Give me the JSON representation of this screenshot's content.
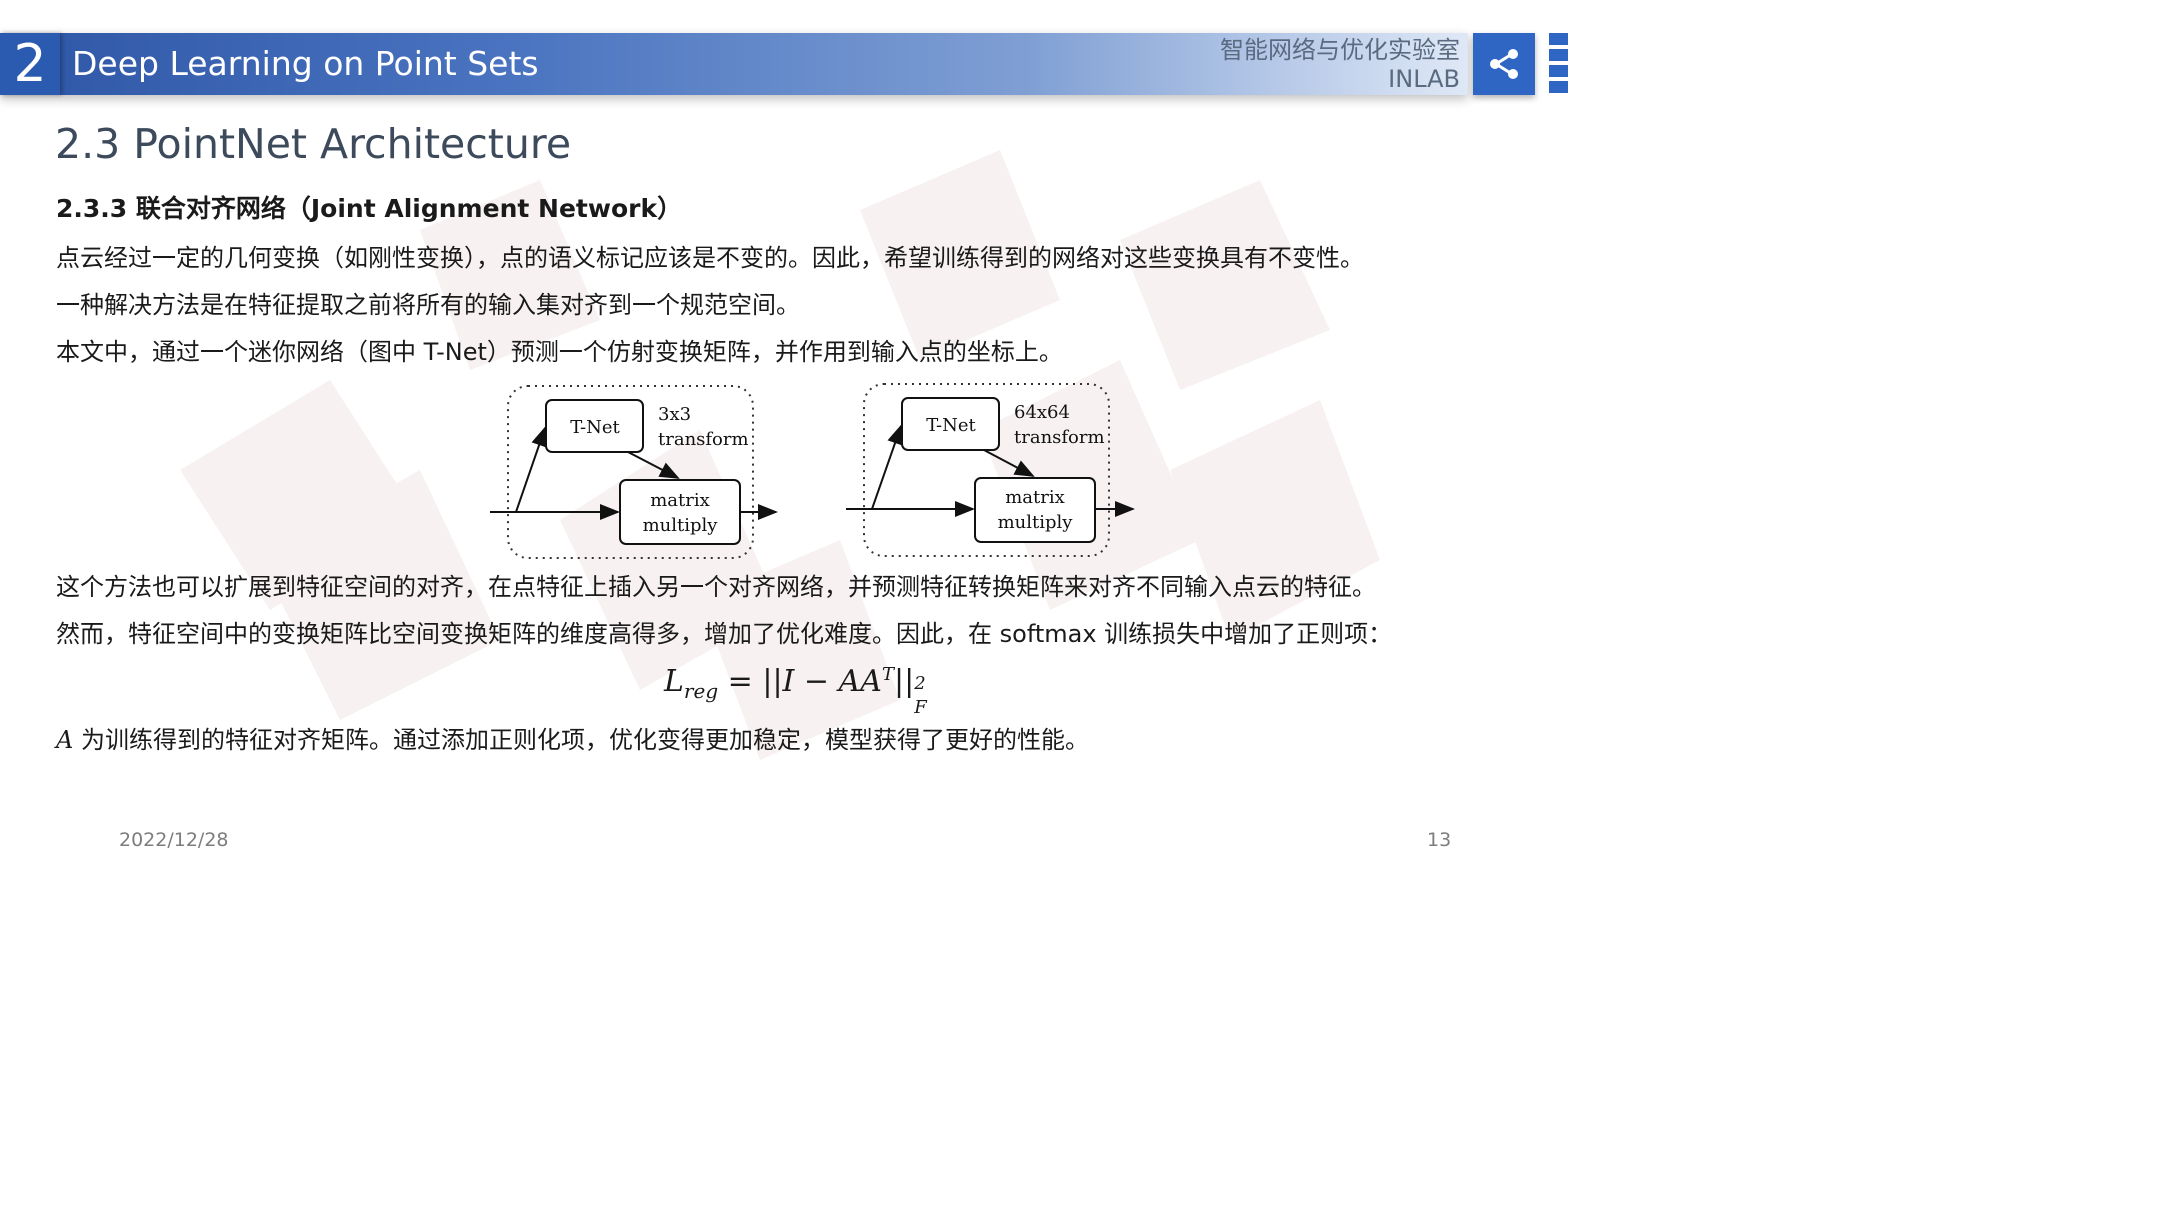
{
  "header": {
    "section_number": "2",
    "title": "Deep Learning on Point Sets",
    "lab_name_cn": "智能网络与优化实验室",
    "lab_name_en": "INLAB"
  },
  "icons": {
    "share": "share-icon",
    "menu": "side-menu-strip"
  },
  "colors": {
    "header_blue": "#2e56a6",
    "badge_blue": "#2a5bb0",
    "share_blue": "#2f66c4"
  },
  "slide": {
    "section_title": "2.3  PointNet Architecture",
    "subsection_title": "2.3.3  联合对齐网络（Joint Alignment Network）",
    "para1": "点云经过一定的几何变换（如刚性变换），点的语义标记应该是不变的。因此，希望训练得到的网络对这些变换具有不变性。",
    "para2": "一种解决方法是在特征提取之前将所有的输入集对齐到一个规范空间。",
    "para3": "本文中，通过一个迷你网络（图中 T-Net）预测一个仿射变换矩阵，并作用到输入点的坐标上。",
    "para4": "这个方法也可以扩展到特征空间的对齐，在点特征上插入另一个对齐网络，并预测特征转换矩阵来对齐不同输入点云的特征。",
    "para5": "然而，特征空间中的变换矩阵比空间变换矩阵的维度高得多，增加了优化难度。因此，在 softmax 训练损失中增加了正则项：",
    "para6_symbol": "A",
    "para6": " 为训练得到的特征对齐矩阵。通过添加正则化项，优化变得更加稳定，模型获得了更好的性能。"
  },
  "diagram": {
    "left": {
      "tnet": "T-Net",
      "transform_l1": "3x3",
      "transform_l2": "transform",
      "matmul_l1": "matrix",
      "matmul_l2": "multiply"
    },
    "right": {
      "tnet": "T-Net",
      "transform_l1": "64x64",
      "transform_l2": "transform",
      "matmul_l1": "matrix",
      "matmul_l2": "multiply"
    }
  },
  "formula": {
    "lhs": "L",
    "lhs_sub": "reg",
    "eq": " = ||I − AA",
    "sup_T": "T",
    "close": "||",
    "sup_2": "2",
    "sub_F": "F"
  },
  "footer": {
    "date": "2022/12/28",
    "page": "13"
  }
}
